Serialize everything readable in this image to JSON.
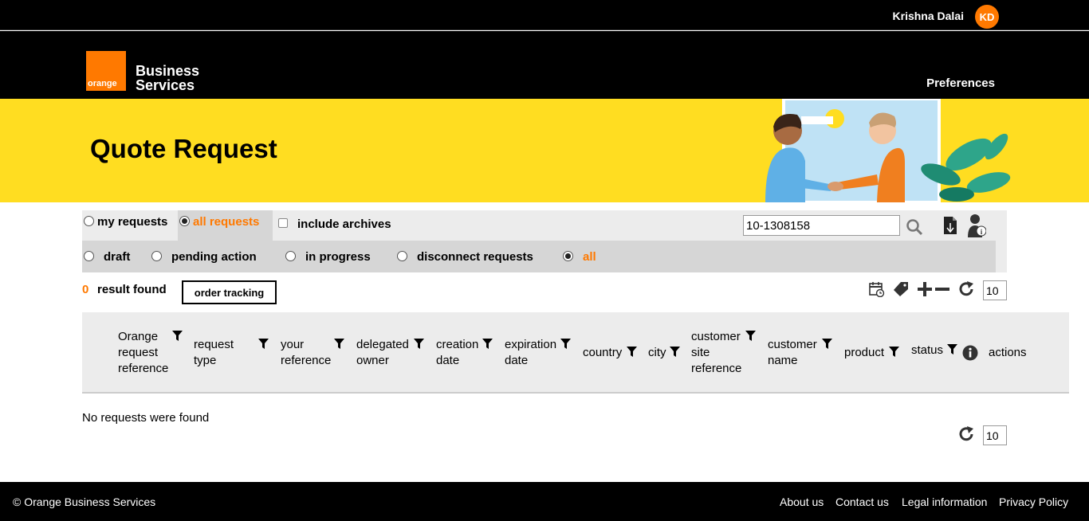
{
  "topbar": {
    "user_name": "Krishna Dalai",
    "avatar_initials": "KD"
  },
  "header": {
    "logo_small": "orange",
    "logo_line1": "Business",
    "logo_line2": "Services",
    "preferences": "Preferences"
  },
  "banner": {
    "title": "Quote Request"
  },
  "filters": {
    "scope": [
      {
        "label": "my requests",
        "selected": false
      },
      {
        "label": "all requests",
        "selected": true
      }
    ],
    "include_archives": "include archives",
    "search_value": "10-1308158",
    "status": [
      {
        "label": "draft",
        "selected": false
      },
      {
        "label": "pending action",
        "selected": false
      },
      {
        "label": "in progress",
        "selected": false
      },
      {
        "label": "disconnect requests",
        "selected": false
      },
      {
        "label": "all",
        "selected": true
      }
    ]
  },
  "results": {
    "count": "0",
    "label": "result found",
    "order_tracking": "order tracking",
    "page_size": "10"
  },
  "table": {
    "columns": [
      "Orange request reference",
      "request type",
      "your reference",
      "delegated owner",
      "creation date",
      "expiration date",
      "country",
      "city",
      "customer site reference",
      "customer name",
      "product",
      "status",
      "actions"
    ],
    "empty_message": "No requests were found"
  },
  "bottom": {
    "page_size": "10"
  },
  "footer": {
    "copyright": "© Orange Business Services",
    "links": [
      "About us",
      "Contact us",
      "Legal information",
      "Privacy Policy"
    ]
  },
  "colors": {
    "accent": "#ff7900",
    "banner": "#ffdd21"
  }
}
